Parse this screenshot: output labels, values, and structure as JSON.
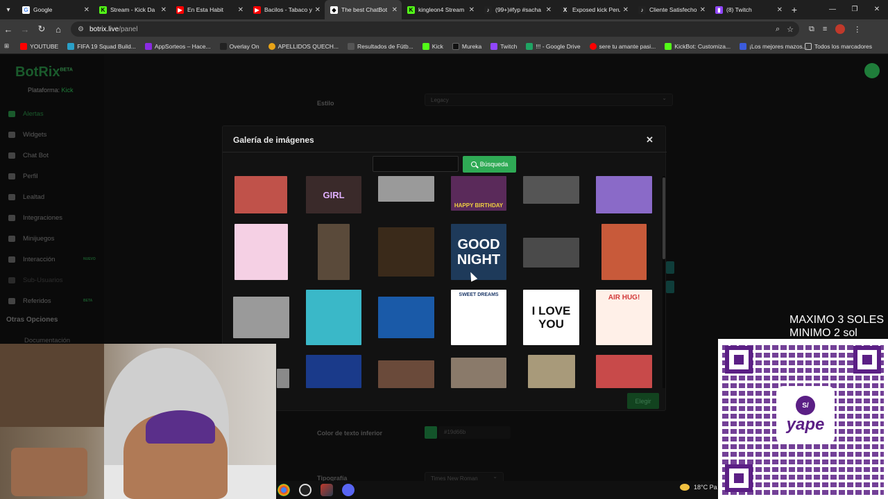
{
  "browser": {
    "tabs": [
      {
        "title": "Google",
        "icon": "google-icon",
        "color": "#ffffff",
        "active": false
      },
      {
        "title": "Stream - Kick Da",
        "icon": "kick-icon",
        "color": "#53fc18",
        "active": false
      },
      {
        "title": "En Esta Habit",
        "icon": "youtube-icon",
        "color": "#ff0000",
        "active": false
      },
      {
        "title": "Bacilos - Tabaco y",
        "icon": "youtube-icon",
        "color": "#ff0000",
        "active": false
      },
      {
        "title": "The best ChatBot",
        "icon": "botrix-icon",
        "color": "#ffffff",
        "active": true
      },
      {
        "title": "kingleon4 Stream",
        "icon": "kick-icon",
        "color": "#53fc18",
        "active": false
      },
      {
        "title": "(99+)#fyp #sacha",
        "icon": "tiktok-icon",
        "color": "#222222",
        "active": false
      },
      {
        "title": "Exposed kick Peru",
        "icon": "x-icon",
        "color": "#222222",
        "active": false
      },
      {
        "title": "Cliente Satisfecho",
        "icon": "tiktok-icon",
        "color": "#222222",
        "active": false
      },
      {
        "title": "(8) Twitch",
        "icon": "twitch-icon",
        "color": "#9146ff",
        "active": false
      }
    ],
    "url_host": "botrix.live",
    "url_path": "/panel",
    "bookmarks": [
      {
        "label": "YOUTUBE",
        "color": "#ff0000"
      },
      {
        "label": "FIFA 19 Squad Build...",
        "color": "#2aa0c8"
      },
      {
        "label": "AppSorteos – Hace...",
        "color": "#8a2be2"
      },
      {
        "label": "Overlay On",
        "color": "#222222"
      },
      {
        "label": "APELLIDOS QUECH...",
        "color": "#e8a317"
      },
      {
        "label": "Resultados de Fútb...",
        "color": "#555555"
      },
      {
        "label": "Kick",
        "color": "#53fc18"
      },
      {
        "label": "Mureka",
        "color": "#111111"
      },
      {
        "label": "Twitch",
        "color": "#9146ff"
      },
      {
        "label": "!!! - Google Drive",
        "color": "#1fa463"
      },
      {
        "label": "sere tu amante pasi...",
        "color": "#ff0000"
      },
      {
        "label": "KickBot: Customiza...",
        "color": "#53fc18"
      },
      {
        "label": "¡Los mejores mazos...",
        "color": "#3b5bdb"
      }
    ],
    "all_bookmarks": "Todos los marcadores"
  },
  "sidebar": {
    "logo": "BotRix",
    "logo_badge": "BETA",
    "platform_label": "Plataforma:",
    "platform_value": "Kick",
    "items": [
      {
        "label": "Alertas",
        "active": true,
        "badge": ""
      },
      {
        "label": "Widgets",
        "active": false,
        "badge": ""
      },
      {
        "label": "Chat Bot",
        "active": false,
        "badge": ""
      },
      {
        "label": "Perfil",
        "active": false,
        "badge": ""
      },
      {
        "label": "Lealtad",
        "active": false,
        "badge": ""
      },
      {
        "label": "Integraciones",
        "active": false,
        "badge": ""
      },
      {
        "label": "Minijuegos",
        "active": false,
        "badge": ""
      },
      {
        "label": "Interacción",
        "active": false,
        "badge": "NUEVO"
      },
      {
        "label": "Sub-Usuarios",
        "active": false,
        "badge": ""
      },
      {
        "label": "Referidos",
        "active": false,
        "badge": "BETA"
      }
    ],
    "section_other": "Otras Opciones",
    "docs": "Documentación"
  },
  "form": {
    "estilo_label": "Estilo",
    "estilo_value": "Legacy",
    "color_texto_inferior_label": "Color de texto inferior",
    "color_texto_inferior_value": "#19d66b",
    "tipografia_label": "Tipografía",
    "tipografia_value": "Times New Roman"
  },
  "modal": {
    "title": "Galería de imágenes",
    "search_value": "",
    "search_button": "Búsqueda",
    "choose_button": "Elegir",
    "gifs": [
      {
        "caption": "",
        "bg": "#c0524a"
      },
      {
        "caption": "GIRL",
        "bg": "#3a2a2a"
      },
      {
        "caption": "",
        "bg": "#9a9a9a"
      },
      {
        "caption": "HAPPY BIRTHDAY",
        "bg": "#5a2a5a"
      },
      {
        "caption": "",
        "bg": "#555555"
      },
      {
        "caption": "",
        "bg": "#8a6ac8"
      },
      {
        "caption": "",
        "bg": "#f5d0e4"
      },
      {
        "caption": "",
        "bg": "#5a4a3a"
      },
      {
        "caption": "",
        "bg": "#3a2a1a"
      },
      {
        "caption": "GOOD NIGHT",
        "bg": "#1e3a5a"
      },
      {
        "caption": "",
        "bg": "#4a4a4a"
      },
      {
        "caption": "",
        "bg": "#c85a3a"
      },
      {
        "caption": "",
        "bg": "#9a9a9a"
      },
      {
        "caption": "",
        "bg": "#3ab8c8"
      },
      {
        "caption": "",
        "bg": "#1a5aa8"
      },
      {
        "caption": "SWEET DREAMS",
        "bg": "#ffffff"
      },
      {
        "caption": "I LOVE YOU",
        "bg": "#ffffff"
      },
      {
        "caption": "AIR HUG!",
        "bg": "#fff0e8"
      },
      {
        "caption": "",
        "bg": "#8a8a8a"
      },
      {
        "caption": "",
        "bg": "#1a3a8a"
      },
      {
        "caption": "",
        "bg": "#6a4a3a"
      },
      {
        "caption": "",
        "bg": "#8a7a6a"
      },
      {
        "caption": "",
        "bg": "#a89a7a"
      },
      {
        "caption": "",
        "bg": "#c84a4a"
      }
    ]
  },
  "overlay": {
    "donation_line1": "MAXIMO 3 SOLES",
    "donation_line2": "MINIMO 2 sol",
    "qr_coin": "S/",
    "qr_brand": "yape"
  },
  "taskbar": {
    "temperature": "18°C",
    "weather_suffix": "Pa"
  }
}
